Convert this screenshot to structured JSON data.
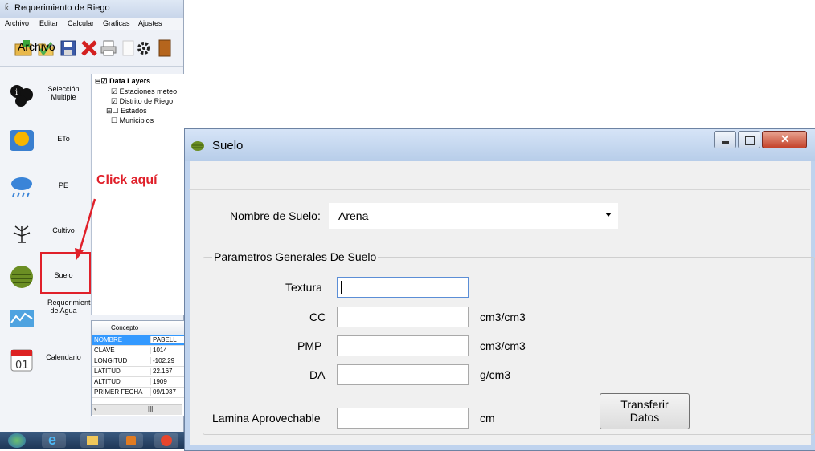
{
  "background_app": {
    "title": "Requerimiento de Riego",
    "menu": [
      "Archivo",
      "Editar",
      "Calcular",
      "Graficas",
      "Ajustes"
    ],
    "sidebar": [
      {
        "label": "Selección Multiple",
        "icon": "info-icon"
      },
      {
        "label": "ETo",
        "icon": "sun-icon"
      },
      {
        "label": "PE",
        "icon": "rain-icon"
      },
      {
        "label": "Cultivo",
        "icon": "plant-icon"
      },
      {
        "label": "Suelo",
        "icon": "soil-icon"
      },
      {
        "label": "Requerimientos de Agua",
        "icon": "water-chart-icon"
      },
      {
        "label": "Calendario",
        "icon": "calendar-icon"
      }
    ],
    "tree": {
      "root": "Data Layers",
      "nodes": [
        "Estaciones meteo",
        "Distrito de Riego",
        "Estados",
        "Municipios"
      ]
    },
    "grid": {
      "header": "Concepto",
      "rows": [
        {
          "key": "NOMBRE",
          "value": "PABELL"
        },
        {
          "key": "CLAVE",
          "value": "1014"
        },
        {
          "key": "LONGITUD",
          "value": "-102.29"
        },
        {
          "key": "LATITUD",
          "value": "22.167"
        },
        {
          "key": "ALTITUD",
          "value": "1909"
        },
        {
          "key": "PRIMER FECHA",
          "value": "09/1937"
        }
      ]
    }
  },
  "annotation": {
    "click_label": "Click aquí",
    "color": "#e0202a"
  },
  "dialog": {
    "title": "Suelo",
    "menu_archivo": "Archivo",
    "nombre_label": "Nombre de Suelo:",
    "nombre_value": "Arena",
    "group_title": "Parametros Generales De Suelo",
    "fields": [
      {
        "label": "Textura",
        "value": "",
        "unit": ""
      },
      {
        "label": "CC",
        "value": "",
        "unit": "cm3/cm3"
      },
      {
        "label": "PMP",
        "value": "",
        "unit": "cm3/cm3"
      },
      {
        "label": "DA",
        "value": "",
        "unit": "g/cm3"
      }
    ],
    "lamina_label": "Lamina Aprovechable",
    "lamina_value": "",
    "lamina_unit": "cm",
    "transfer_button_line1": "Transferir",
    "transfer_button_line2": "Datos"
  }
}
